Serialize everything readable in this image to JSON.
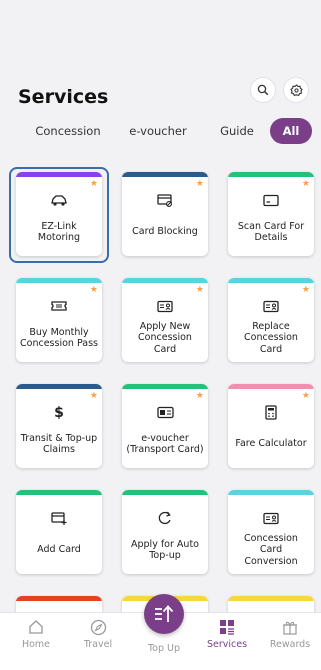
{
  "header": {
    "title": "Services",
    "search_icon": "search-icon",
    "settings_icon": "badge-gear-icon"
  },
  "tabs": [
    {
      "label": "Concession",
      "active": false
    },
    {
      "label": "e-voucher",
      "active": false
    },
    {
      "label": "Guide",
      "active": false
    },
    {
      "label": "All",
      "active": true
    }
  ],
  "colors": {
    "accent": "#7b3f8a",
    "star": "#f4a24b",
    "purple": "#8a3ff0",
    "navy": "#2a5b8c",
    "green": "#22c27a",
    "cyan": "#58d3e2",
    "pink": "#f28fb1",
    "red": "#e4431f",
    "yellow": "#f7d73a"
  },
  "services": [
    {
      "label": "EZ-Link Motoring",
      "icon": "car-icon",
      "strip": "purple",
      "star": true,
      "selected": true
    },
    {
      "label": "Card Blocking",
      "icon": "card-block-icon",
      "strip": "navy",
      "star": true
    },
    {
      "label": "Scan Card For Details",
      "icon": "card-icon",
      "strip": "green",
      "star": true
    },
    {
      "label": "Buy Monthly Concession Pass",
      "icon": "ticket-icon",
      "strip": "cyan",
      "star": true
    },
    {
      "label": "Apply New Concession Card",
      "icon": "id-card-icon",
      "strip": "cyan",
      "star": true
    },
    {
      "label": "Replace Concession Card",
      "icon": "id-card-icon",
      "strip": "cyan",
      "star": true
    },
    {
      "label": "Transit & Top-up Claims",
      "icon": "dollar-icon",
      "strip": "navy",
      "star": true
    },
    {
      "label": "e-voucher (Transport Card)",
      "icon": "voucher-card-icon",
      "strip": "green",
      "star": true
    },
    {
      "label": "Fare Calculator",
      "icon": "calculator-icon",
      "strip": "pink",
      "star": true
    },
    {
      "label": "Add Card",
      "icon": "add-card-icon",
      "strip": "green",
      "star": false
    },
    {
      "label": "Apply for Auto Top-up",
      "icon": "refresh-icon",
      "strip": "green",
      "star": false
    },
    {
      "label": "Concession Card Conversion",
      "icon": "id-card-icon",
      "strip": "cyan",
      "star": false
    },
    {
      "label": "",
      "icon": "voucher-card-icon",
      "strip": "red",
      "star": false
    },
    {
      "label": "",
      "icon": "card-icon",
      "strip": "yellow",
      "star": false
    },
    {
      "label": "",
      "icon": "gift-icon",
      "strip": "yellow",
      "star": false
    }
  ],
  "nav": [
    {
      "label": "Home",
      "icon": "home-icon",
      "active": false
    },
    {
      "label": "Travel",
      "icon": "compass-icon",
      "active": false
    },
    {
      "label": "Top Up",
      "icon": "topup-icon",
      "active": false
    },
    {
      "label": "Services",
      "icon": "grid-icon",
      "active": true
    },
    {
      "label": "Rewards",
      "icon": "gift-icon",
      "active": false
    }
  ]
}
